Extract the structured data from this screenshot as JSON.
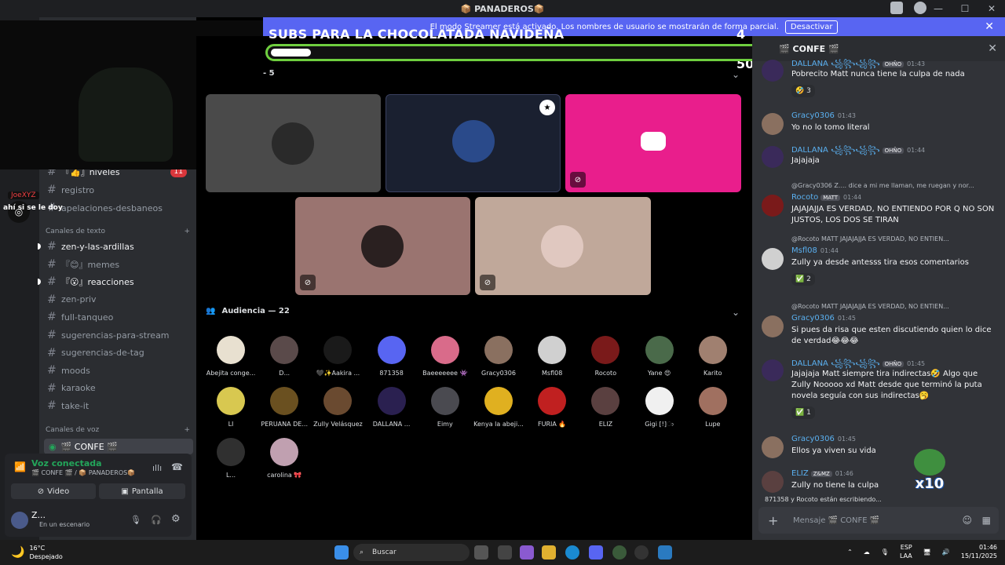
{
  "window": {
    "title": "📦 PANADEROS📦"
  },
  "banner": {
    "text": "El modo Streamer está activado. Los nombres de usuario se mostrarán de forma parcial.",
    "button": "Desactivar"
  },
  "overlay": {
    "goal_title": "SUBS PARA LA CHOCOLATADA NAVIDEÑA",
    "goal_count": "4  / 50",
    "goal_progress": 0.08,
    "webcam_tag": "JoeXYZ",
    "caption": "ahí si se le doy"
  },
  "sidebar": {
    "channels_top": [
      {
        "label": "『👍』niveles",
        "badge": "11",
        "unread": true
      },
      {
        "label": "registro",
        "unread": false
      },
      {
        "label": "apelaciones-desbaneos",
        "unread": false
      }
    ],
    "text_category": "Canales de texto",
    "text_channels": [
      {
        "label": "zen-y-las-ardillas",
        "unread": true
      },
      {
        "label": "『😊』memes",
        "unread": false
      },
      {
        "label": "『😮』reacciones",
        "unread": true
      },
      {
        "label": "zen-priv",
        "unread": false
      },
      {
        "label": "full-tanqueo",
        "unread": false
      },
      {
        "label": "sugerencias-para-stream",
        "unread": false
      },
      {
        "label": "sugerencias-de-tag",
        "unread": false
      },
      {
        "label": "moods",
        "unread": false
      },
      {
        "label": "karaoke",
        "unread": false
      },
      {
        "label": "take-it",
        "unread": false
      }
    ],
    "voice_category": "Canales de voz",
    "active_voice": "🎬 CONFE 🎬"
  },
  "voice_panel": {
    "status": "Voz conectada",
    "location": "🎬 CONFE 🎬 / 📦 PANADEROS📦",
    "video_button": "Video",
    "screen_button": "Pantalla",
    "user_name": "Z...",
    "user_status": "En un escenario"
  },
  "stage": {
    "speakers_header": "- 5",
    "audience_header": "Audiencia — 22",
    "audience": [
      {
        "name": "Abejita conge...",
        "color": "#e8e0d0"
      },
      {
        "name": "D...",
        "color": "#5a4a4a"
      },
      {
        "name": "🖤✨Aakira ...",
        "color": "#1a1a1a"
      },
      {
        "name": "871358",
        "color": "#5865f2"
      },
      {
        "name": "Baeeeeeee 👾",
        "color": "#d96b8a"
      },
      {
        "name": "Gracy0306",
        "color": "#8a7060"
      },
      {
        "name": "Msfl08",
        "color": "#d0d0d0"
      },
      {
        "name": "Rocoto",
        "color": "#7a1a1a"
      },
      {
        "name": "Yane 😍",
        "color": "#4a6a4a"
      },
      {
        "name": "Karito",
        "color": "#a08070"
      },
      {
        "name": "LI",
        "color": "#d8c850"
      },
      {
        "name": "PERUANA DE...",
        "color": "#6a5020"
      },
      {
        "name": "Zully Velásquez",
        "color": "#6a4a30"
      },
      {
        "name": "DALLANA ...",
        "color": "#2a2050"
      },
      {
        "name": "Eimy",
        "color": "#4a4a50"
      },
      {
        "name": "Kenya la abeji...",
        "color": "#e0b020"
      },
      {
        "name": "FURIA 🔥",
        "color": "#c02020"
      },
      {
        "name": "ELIZ",
        "color": "#5a4040"
      },
      {
        "name": "Gigi [!]ා",
        "color": "#f0f0f0"
      },
      {
        "name": "Lupe",
        "color": "#a07060"
      },
      {
        "name": "L...",
        "color": "#303030"
      },
      {
        "name": "carolina 🎀",
        "color": "#c0a0b0"
      }
    ]
  },
  "chat": {
    "channel": "🎬 CONFE 🎬",
    "messages": [
      {
        "name": "DALLANA ꧁꧂꧁꧂",
        "tag": "OHÑO",
        "time": "01:43",
        "text": "Pobrecito Matt nunca tiene la culpa de nada",
        "reaction": "🤣 3"
      },
      {
        "name": "Gracy0306",
        "time": "01:43",
        "text": "Yo no lo tomo literal"
      },
      {
        "name": "DALLANA ꧁꧂꧁꧂",
        "tag": "OHÑO",
        "time": "01:44",
        "text": "Jajajaja"
      },
      {
        "name": "Rocoto",
        "tag": "MATT",
        "time": "01:44",
        "reply": "@Gracy0306  Z.... dice a mi me llaman, me ruegan y nor...",
        "text": "JAJAJAJJA ES VERDAD, NO ENTIENDO POR Q NO SON JUSTOS, LOS DOS SE TIRAN"
      },
      {
        "name": "Msfl08",
        "tag": "",
        "time": "01:44",
        "reply": "@Rocoto  MATT  JAJAJAJJA ES VERDAD, NO ENTIEN...",
        "text": "Zully ya desde antesss tira esos comentarios",
        "reaction": "✅ 2"
      },
      {
        "name": "Gracy0306",
        "time": "01:45",
        "reply": "@Rocoto  MATT  JAJAJAJJA ES VERDAD, NO ENTIEN...",
        "text": "Si pues da risa que esten discutiendo quien lo dice de verdad😂😂😂"
      },
      {
        "name": "DALLANA ꧁꧂꧁꧂",
        "tag": "OHÑO",
        "time": "01:45",
        "text": "Jajajaja Matt siempre tira indirectas🤣 Algo que Zully Nooooo xd Matt desde que terminó la puta novela seguía con sus indirectas🥱",
        "reaction": "✅ 1"
      },
      {
        "name": "Gracy0306",
        "time": "01:45",
        "text": "Ellos ya viven su vida"
      },
      {
        "name": "ELIZ",
        "tag": "Z&MZ",
        "time": "01:46",
        "text": "Zully no tiene la culpa"
      }
    ],
    "typing": "871358 y Rocoto están escribiendo...",
    "input_placeholder": "Mensaje 🎬 CONFE 🎬",
    "sticker": "x10"
  },
  "taskbar": {
    "temp": "16°C",
    "weather": "Despejado",
    "search": "Buscar",
    "lang1": "ESP",
    "lang2": "LAA",
    "time": "01:46",
    "date": "15/11/2025"
  }
}
